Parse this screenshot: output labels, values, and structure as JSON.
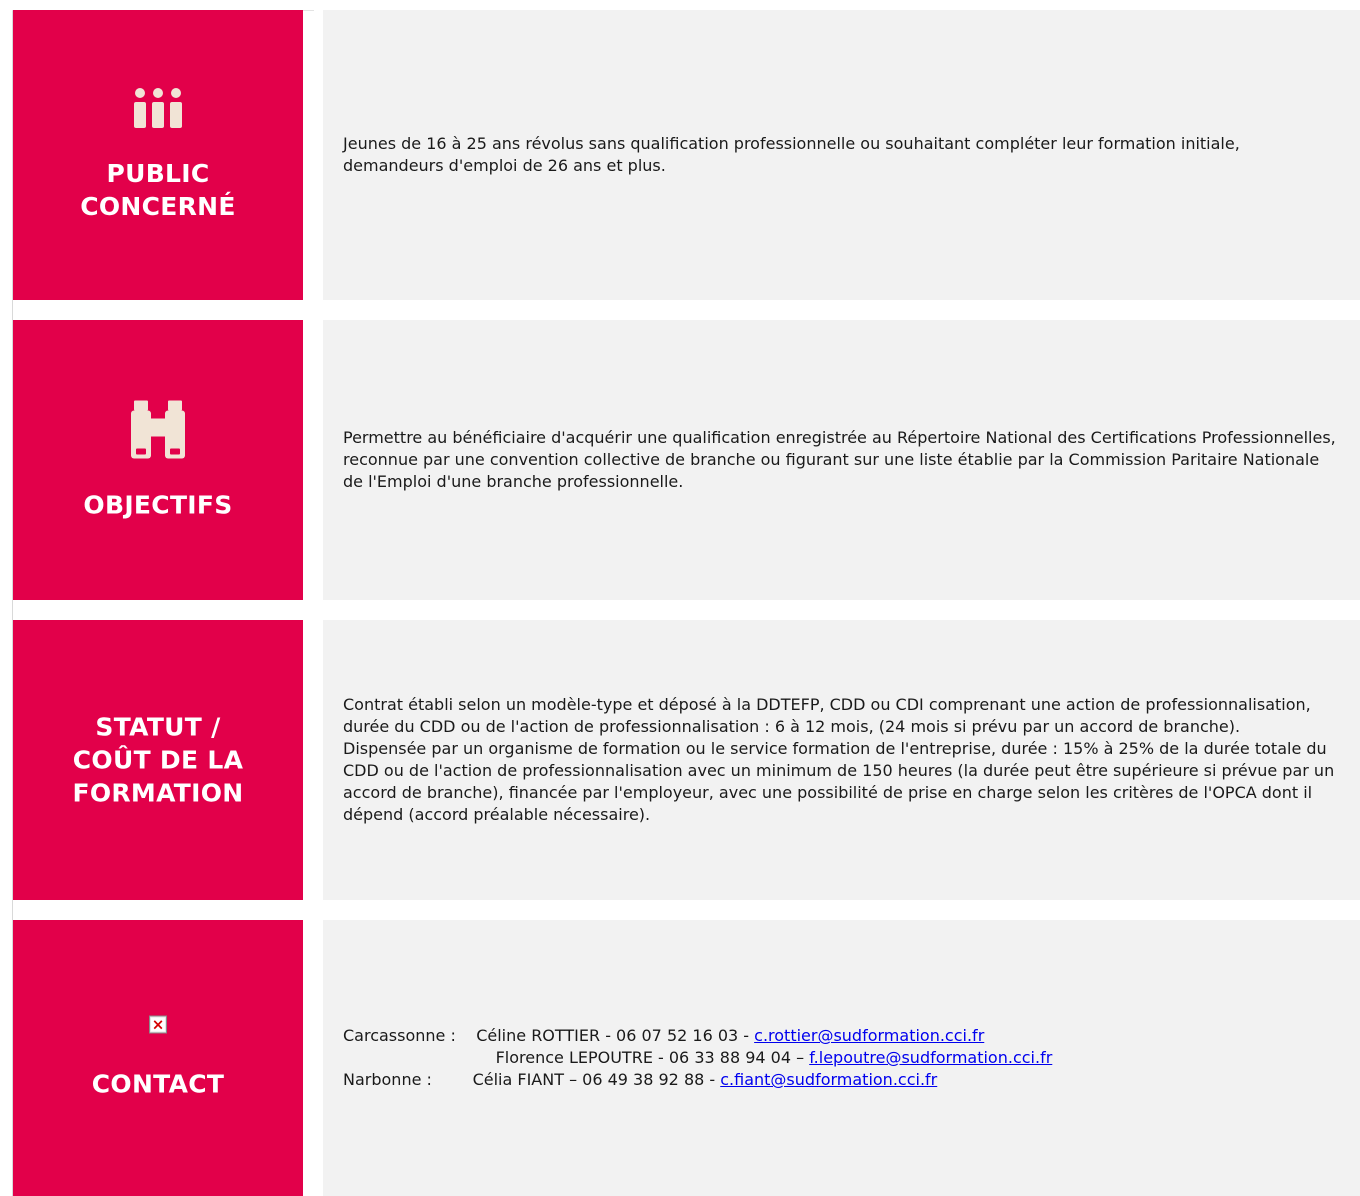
{
  "sections": [
    {
      "title": "PUBLIC\nCONCERNÉ",
      "icon": "people-icon",
      "text": "Jeunes de 16 à 25 ans révolus sans qualification professionnelle ou souhaitant compléter leur formation initiale, demandeurs d'emploi de 26 ans et plus."
    },
    {
      "title": "OBJECTIFS",
      "icon": "binoculars-icon",
      "text": "Permettre au bénéficiaire d'acquérir une qualification enregistrée au Répertoire National des Certifications Professionnelles, reconnue par une convention collective de branche ou figurant sur une liste établie par la Commission Paritaire Nationale de l'Emploi d'une branche professionnelle."
    },
    {
      "title": "STATUT /\nCOÛT DE LA\nFORMATION",
      "icon": "",
      "paragraphs": [
        "Contrat établi selon un modèle-type et déposé à la DDTEFP, CDD ou CDI comprenant une action de professionnalisation, durée du CDD ou de l'action de professionnalisation : 6 à 12 mois, (24 mois si prévu par un accord de branche).",
        "Dispensée par un organisme de formation ou le service formation de l'entreprise, durée : 15% à 25% de la durée totale du CDD ou de l'action de professionnalisation avec un minimum de 150 heures (la durée peut être supérieure si prévue par un accord de branche), financée par l'employeur, avec une possibilité de prise en charge selon les critères de l'OPCA dont il dépend (accord préalable nécessaire)."
      ]
    },
    {
      "title": "CONTACT",
      "icon": "broken-image-icon",
      "contacts": [
        {
          "prefix": "Carcassonne :    Céline ROTTIER - 06 07 52 16 03 - ",
          "email": "c.rottier@sudformation.cci.fr"
        },
        {
          "prefix": "                              Florence LEPOUTRE - 06 33 88 94 04 – ",
          "email": "f.lepoutre@sudformation.cci.fr"
        },
        {
          "prefix": "Narbonne :        Célia FIANT – 06 49 38 92 88 - ",
          "email": "c.fiant@sudformation.cci.fr"
        }
      ]
    }
  ],
  "colors": {
    "tile": "#e2004a",
    "panel": "#f2f2f2",
    "icon": "#f1e4d6",
    "link": "#0000ee"
  }
}
